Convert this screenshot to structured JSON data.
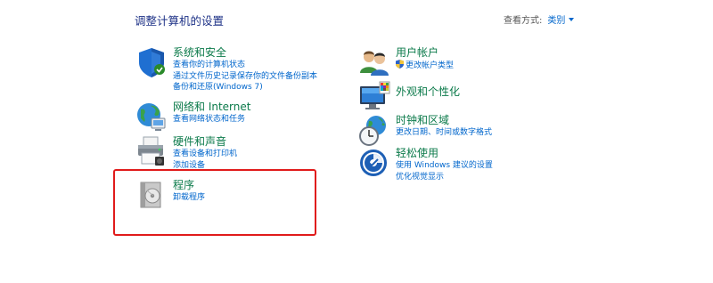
{
  "header": {
    "title": "调整计算机的设置",
    "viewby_label": "查看方式:",
    "viewby_value": "类别"
  },
  "categories": {
    "system": {
      "title": "系统和安全",
      "links": [
        "查看你的计算机状态",
        "通过文件历史记录保存你的文件备份副本",
        "备份和还原(Windows 7)"
      ]
    },
    "network": {
      "title": "网络和 Internet",
      "links": [
        "查看网络状态和任务"
      ]
    },
    "hardware": {
      "title": "硬件和声音",
      "links": [
        "查看设备和打印机",
        "添加设备"
      ]
    },
    "programs": {
      "title": "程序",
      "links": [
        "卸载程序"
      ]
    },
    "users": {
      "title": "用户帐户",
      "links": [
        "更改帐户类型"
      ]
    },
    "appearance": {
      "title": "外观和个性化",
      "links": []
    },
    "clock": {
      "title": "时钟和区域",
      "links": [
        "更改日期、时间或数字格式"
      ]
    },
    "ease": {
      "title": "轻松使用",
      "links": [
        "使用 Windows 建议的设置",
        "优化视觉显示"
      ]
    }
  },
  "highlight_color": "#e01b1b",
  "link_color": "#0066cc",
  "title_color": "#0b7a4a"
}
